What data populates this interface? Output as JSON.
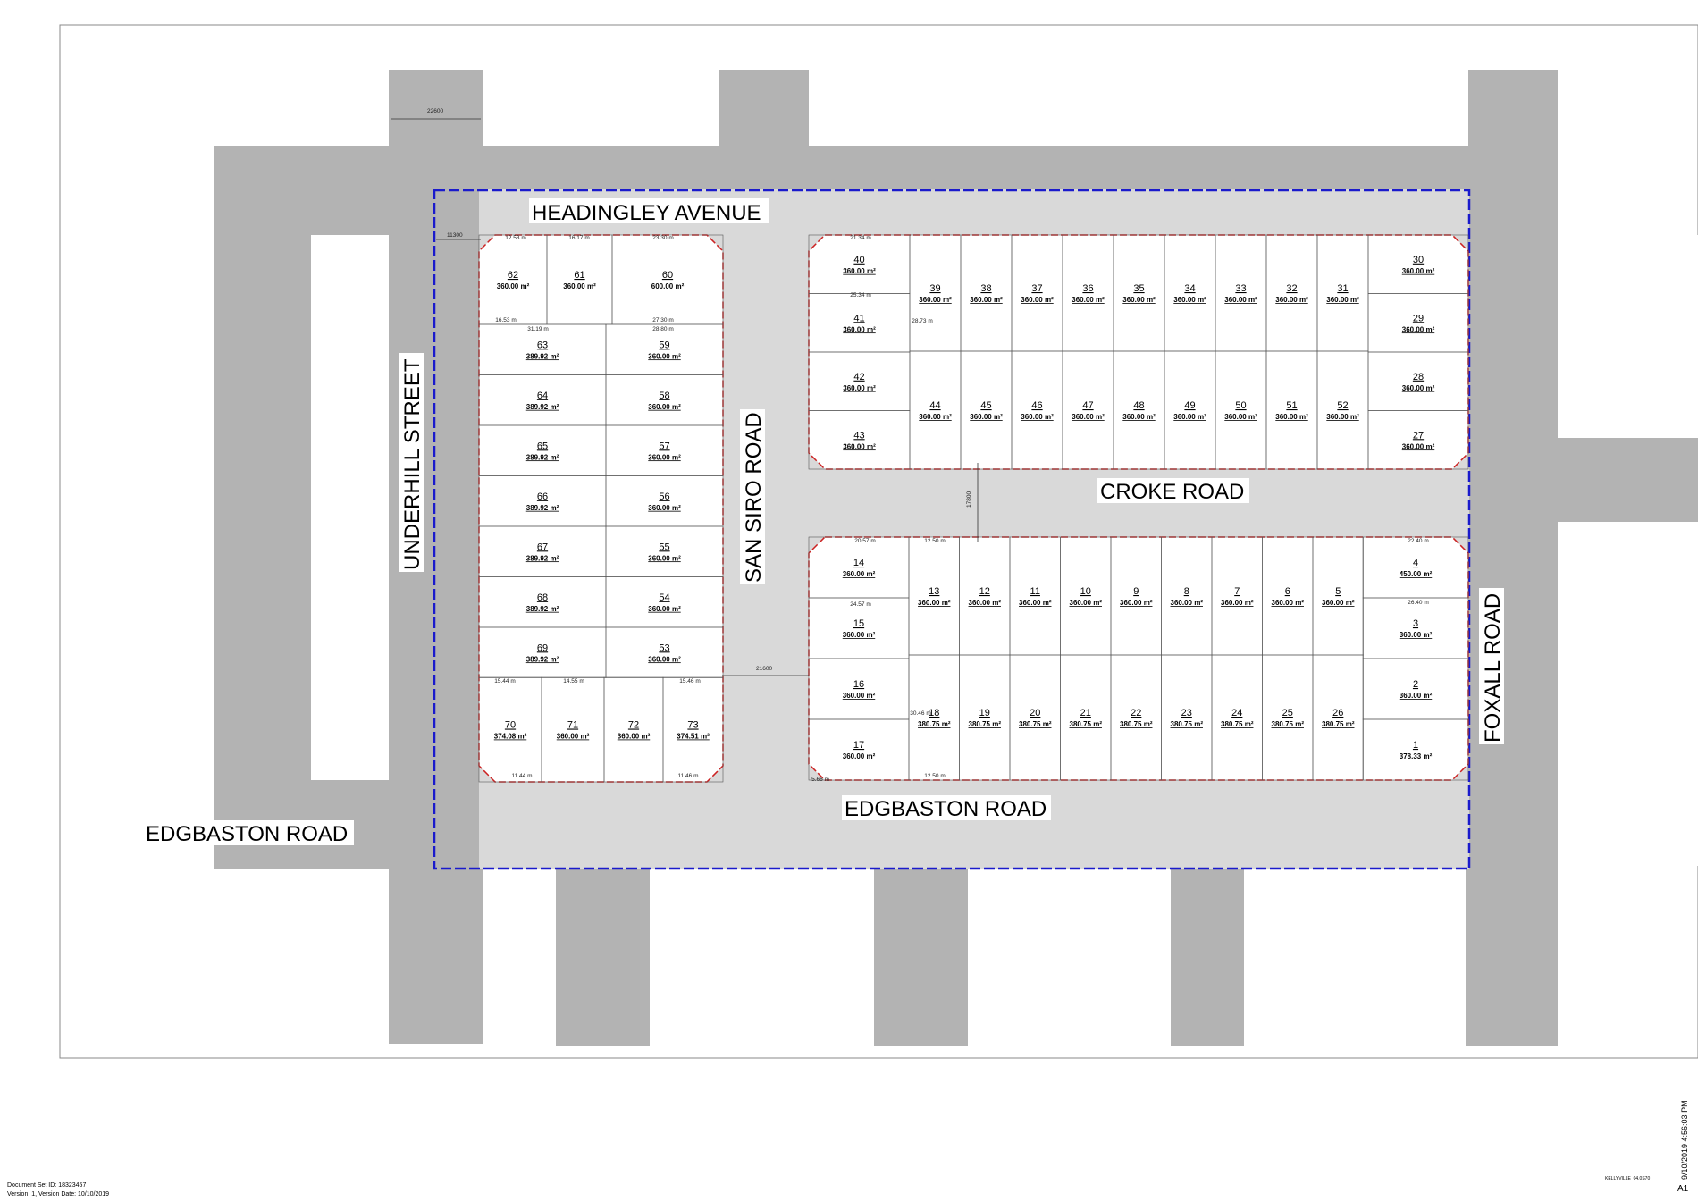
{
  "roads": {
    "headingley": "HEADINGLEY AVENUE",
    "underhill": "UNDERHILL STREET",
    "san_siro": "SAN SIRO ROAD",
    "croke": "CROKE ROAD",
    "edgbaston_main": "EDGBASTON ROAD",
    "edgbaston_left": "EDGBASTON ROAD",
    "foxall": "FOXALL ROAD"
  },
  "dimensions": {
    "d22600": "22600",
    "d11300": "11300",
    "d17800": "17800",
    "d21600": "21600"
  },
  "footer": {
    "doc_id": "Document Set ID: 18323457",
    "version": "Version: 1, Version Date: 10/10/2019",
    "timestamp": "9/10/2019 4:56:03 PM",
    "sheet": "A1",
    "file_ref": "KELLYVILLE_04.0S70"
  },
  "lots": [
    {
      "n": "62",
      "a": "360.00 m²"
    },
    {
      "n": "61",
      "a": "360.00 m²"
    },
    {
      "n": "60",
      "a": "600.00 m²"
    },
    {
      "n": "63",
      "a": "389.92 m²"
    },
    {
      "n": "64",
      "a": "389.92 m²"
    },
    {
      "n": "65",
      "a": "389.92 m²"
    },
    {
      "n": "66",
      "a": "389.92 m²"
    },
    {
      "n": "67",
      "a": "389.92 m²"
    },
    {
      "n": "68",
      "a": "389.92 m²"
    },
    {
      "n": "69",
      "a": "389.92 m²"
    },
    {
      "n": "59",
      "a": "360.00 m²"
    },
    {
      "n": "58",
      "a": "360.00 m²"
    },
    {
      "n": "57",
      "a": "360.00 m²"
    },
    {
      "n": "56",
      "a": "360.00 m²"
    },
    {
      "n": "55",
      "a": "360.00 m²"
    },
    {
      "n": "54",
      "a": "360.00 m²"
    },
    {
      "n": "53",
      "a": "360.00 m²"
    },
    {
      "n": "70",
      "a": "374.08 m²"
    },
    {
      "n": "71",
      "a": "360.00 m²"
    },
    {
      "n": "72",
      "a": "360.00 m²"
    },
    {
      "n": "73",
      "a": "374.51 m²"
    },
    {
      "n": "40",
      "a": "360.00 m²"
    },
    {
      "n": "41",
      "a": "360.00 m²"
    },
    {
      "n": "42",
      "a": "360.00 m²"
    },
    {
      "n": "43",
      "a": "360.00 m²"
    },
    {
      "n": "39",
      "a": "360.00 m²"
    },
    {
      "n": "38",
      "a": "360.00 m²"
    },
    {
      "n": "37",
      "a": "360.00 m²"
    },
    {
      "n": "36",
      "a": "360.00 m²"
    },
    {
      "n": "35",
      "a": "360.00 m²"
    },
    {
      "n": "34",
      "a": "360.00 m²"
    },
    {
      "n": "33",
      "a": "360.00 m²"
    },
    {
      "n": "32",
      "a": "360.00 m²"
    },
    {
      "n": "31",
      "a": "360.00 m²"
    },
    {
      "n": "44",
      "a": "360.00 m²"
    },
    {
      "n": "45",
      "a": "360.00 m²"
    },
    {
      "n": "46",
      "a": "360.00 m²"
    },
    {
      "n": "47",
      "a": "360.00 m²"
    },
    {
      "n": "48",
      "a": "360.00 m²"
    },
    {
      "n": "49",
      "a": "360.00 m²"
    },
    {
      "n": "50",
      "a": "360.00 m²"
    },
    {
      "n": "51",
      "a": "360.00 m²"
    },
    {
      "n": "52",
      "a": "360.00 m²"
    },
    {
      "n": "30",
      "a": "360.00 m²"
    },
    {
      "n": "29",
      "a": "360.00 m²"
    },
    {
      "n": "28",
      "a": "360.00 m²"
    },
    {
      "n": "27",
      "a": "360.00 m²"
    },
    {
      "n": "14",
      "a": "360.00 m²"
    },
    {
      "n": "15",
      "a": "360.00 m²"
    },
    {
      "n": "16",
      "a": "360.00 m²"
    },
    {
      "n": "17",
      "a": "360.00 m²"
    },
    {
      "n": "13",
      "a": "360.00 m²"
    },
    {
      "n": "12",
      "a": "360.00 m²"
    },
    {
      "n": "11",
      "a": "360.00 m²"
    },
    {
      "n": "10",
      "a": "360.00 m²"
    },
    {
      "n": "9",
      "a": "360.00 m²"
    },
    {
      "n": "8",
      "a": "360.00 m²"
    },
    {
      "n": "7",
      "a": "360.00 m²"
    },
    {
      "n": "6",
      "a": "360.00 m²"
    },
    {
      "n": "5",
      "a": "360.00 m²"
    },
    {
      "n": "18",
      "a": "380.75 m²"
    },
    {
      "n": "19",
      "a": "380.75 m²"
    },
    {
      "n": "20",
      "a": "380.75 m²"
    },
    {
      "n": "21",
      "a": "380.75 m²"
    },
    {
      "n": "22",
      "a": "380.75 m²"
    },
    {
      "n": "23",
      "a": "380.75 m²"
    },
    {
      "n": "24",
      "a": "380.75 m²"
    },
    {
      "n": "25",
      "a": "380.75 m²"
    },
    {
      "n": "26",
      "a": "380.75 m²"
    },
    {
      "n": "4",
      "a": "450.00 m²"
    },
    {
      "n": "3",
      "a": "360.00 m²"
    },
    {
      "n": "2",
      "a": "360.00 m²"
    },
    {
      "n": "1",
      "a": "378.33 m²"
    }
  ],
  "frontages": [
    "12.53 m",
    "16.17 m",
    "23.30 m",
    "16.53 m",
    "27.30 m",
    "31.19 m",
    "28.80 m",
    "15.44 m",
    "14.55 m",
    "15.46 m",
    "11.44 m",
    "11.46 m",
    "21.34 m",
    "25.34 m",
    "20.57 m",
    "24.57 m",
    "12.50 m",
    "22.40 m",
    "26.40 m",
    "12.50 m",
    "28.73 m",
    "30.46 m",
    "5.66 m"
  ]
}
